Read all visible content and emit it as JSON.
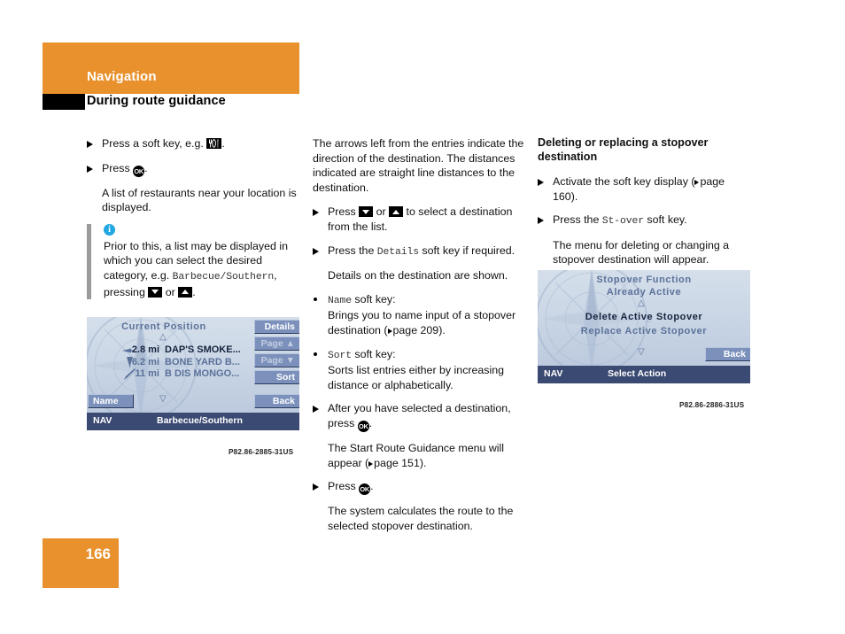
{
  "header": {
    "section": "Navigation",
    "subsection": "During route guidance"
  },
  "footer": {
    "page_number": "166"
  },
  "colors": {
    "accent_orange": "#e8912d",
    "info_blue": "#22a7e0",
    "nav_bar": "#3b4a72",
    "softkey": "#7b90bb",
    "screen_bg": "#cbd7e6"
  },
  "col1": {
    "b1": {
      "pre": "Press a soft key, e.g.",
      "icon": "restaurant-soft-key-icon",
      "post": "."
    },
    "b2": {
      "pre": "Press",
      "icon": "ok-button-icon",
      "post": "."
    },
    "p1": "A list of restaurants near your location is displayed.",
    "note": {
      "icon": "info-icon",
      "t1": "Prior to this, a list may be displayed in which you can select the desired category, e.g.",
      "mono": "Barbecue/Southern",
      "t2": ", pressing",
      "icon_down": "down-arrow-key-icon",
      "mid": "or",
      "icon_up": "up-arrow-key-icon",
      "t3": "."
    },
    "caption": "P82.86-2885-31US",
    "screen": {
      "title": "Current Position",
      "scroll_up": "△",
      "scroll_down": "▽",
      "entries": [
        {
          "dir": "arrow-right-icon",
          "dist": "2.8 mi",
          "name": "DAP'S SMOKE...",
          "selected": true
        },
        {
          "dir": "arrow-down-icon",
          "dist": "6.2 mi",
          "name": "BONE YARD B...",
          "selected": false
        },
        {
          "dir": "arrow-down-left-icon",
          "dist": "11 mi",
          "name": "B DIS MONGO...",
          "selected": false
        }
      ],
      "softkeys_right": [
        {
          "label": "Details",
          "dim": false
        },
        {
          "label": "Page ▲",
          "dim": true
        },
        {
          "label": "Page ▼",
          "dim": true
        },
        {
          "label": "Sort",
          "dim": false
        },
        {
          "label": "Back",
          "dim": false
        }
      ],
      "softkey_left": {
        "label": "Name"
      },
      "status_left": "NAV",
      "status_title": "Barbecue/Southern"
    }
  },
  "col2": {
    "p1": "The arrows left from the entries indicate the direction of the destination. The distances indicated are straight line distances to the destination.",
    "b1": {
      "pre": "Press",
      "icon_down": "down-arrow-key-icon",
      "mid": "or",
      "icon_up": "up-arrow-key-icon",
      "post": "to select a destination from the list."
    },
    "b2": {
      "pre": "Press the",
      "mono": "Details",
      "post": "soft key if required."
    },
    "p2": "Details on the destination are shown.",
    "d1": {
      "mono": "Name",
      "label": "soft key:",
      "body_pre": "Brings you to name input of a stopover destination (",
      "ref": "page 209",
      "body_post": ")."
    },
    "d2": {
      "mono": "Sort",
      "label": "soft key:",
      "body": "Sorts list entries either by increasing distance or alphabetically."
    },
    "b3": {
      "pre": "After you have selected a destination, press",
      "icon": "ok-button-icon",
      "post": "."
    },
    "p3_pre": "The Start Route Guidance menu will appear (",
    "p3_ref": "page 151",
    "p3_post": ").",
    "b4": {
      "pre": "Press",
      "icon": "ok-button-icon",
      "post": "."
    },
    "p4": "The system calculates the route to the selected stopover destination."
  },
  "col3": {
    "heading": "Deleting or replacing a stopover destination",
    "b1": {
      "pre": "Activate the soft key display (",
      "ref": "page 160",
      "post": ")."
    },
    "b2": {
      "pre": "Press the",
      "mono": "St-over",
      "post": "soft key."
    },
    "p1": "The menu for deleting or changing a stopover destination will appear.",
    "caption": "P82.86-2886-31US",
    "screen": {
      "title1": "Stopover Function",
      "title2": "Already Active",
      "scroll_up": "△",
      "scroll_down": "▽",
      "items": [
        {
          "label": "Delete Active Stopover",
          "selected": true
        },
        {
          "label": "Replace Active Stopover",
          "selected": false
        }
      ],
      "softkey_back": {
        "label": "Back"
      },
      "status_left": "NAV",
      "status_title": "Select Action"
    }
  }
}
